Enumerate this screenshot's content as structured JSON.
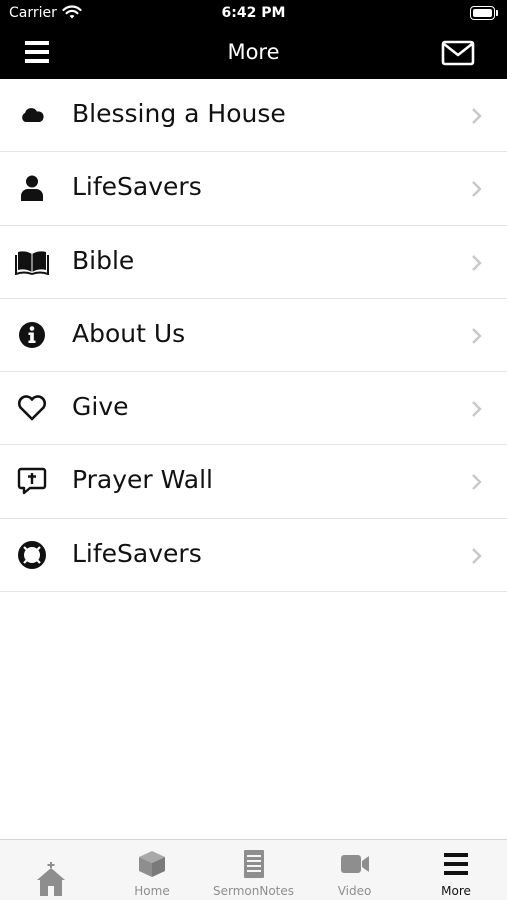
{
  "status_bar": {
    "carrier": "Carrier",
    "time": "6:42 PM",
    "wifi_icon": "wifi-icon",
    "battery_icon": "battery-icon"
  },
  "nav_bar": {
    "title": "More",
    "menu_icon": "hamburger-menu-icon",
    "mail_icon": "envelope-icon"
  },
  "menu_items": [
    {
      "label": "Blessing a House",
      "icon": "cloud-icon"
    },
    {
      "label": "LifeSavers",
      "icon": "user-icon"
    },
    {
      "label": "Bible",
      "icon": "open-book-icon"
    },
    {
      "label": "About Us",
      "icon": "info-circle-icon"
    },
    {
      "label": "Give",
      "icon": "heart-icon"
    },
    {
      "label": "Prayer Wall",
      "icon": "prayer-bubble-icon"
    },
    {
      "label": "LifeSavers",
      "icon": "life-ring-icon"
    }
  ],
  "tab_bar": {
    "tabs": [
      {
        "label": "",
        "icon": "church-icon",
        "active": false
      },
      {
        "label": "Home",
        "icon": "cube-icon",
        "active": false
      },
      {
        "label": "SermonNotes",
        "icon": "notes-icon",
        "active": false
      },
      {
        "label": "Video",
        "icon": "video-camera-icon",
        "active": false
      },
      {
        "label": "More",
        "icon": "hamburger-menu-icon",
        "active": true
      }
    ]
  },
  "colors": {
    "header_bg": "#000000",
    "header_text": "#ffffff",
    "list_text": "#111111",
    "chevron": "#c7c7cc",
    "tab_inactive": "#8e8e8e",
    "tab_active": "#111111",
    "tabbar_bg": "#f6f6f6"
  }
}
